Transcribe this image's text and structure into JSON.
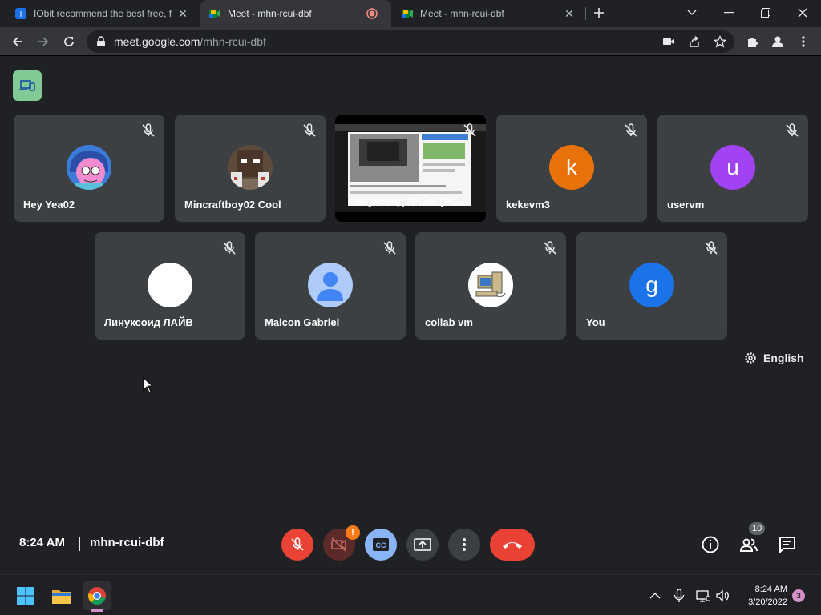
{
  "browser": {
    "tabs": [
      {
        "title": "IObit recommend the best free, f",
        "active": false
      },
      {
        "title": "Meet - mhn-rcui-dbf",
        "active": true
      },
      {
        "title": "Meet - mhn-rcui-dbf",
        "active": false
      }
    ],
    "url_host": "meet.google.com",
    "url_path": "/mhn-rcui-dbf"
  },
  "meet": {
    "participants_row1": [
      {
        "name": "Hey Yea02",
        "avatar": "pink-cartoon-avatar"
      },
      {
        "name": "Mincraftboy02 Cool",
        "avatar": "minecraft-avatar"
      },
      {
        "name": "Линуксоид ЛАЙВ (Pr...",
        "avatar": "screen-share"
      },
      {
        "name": "kekevm3",
        "avatar_letter": "k",
        "color": "#e8710a"
      },
      {
        "name": "uservm",
        "avatar_letter": "u",
        "color": "#a142f4"
      }
    ],
    "participants_row2": [
      {
        "name": "Линуксоид ЛАЙВ",
        "avatar": "white-circle"
      },
      {
        "name": "Maicon Gabriel",
        "avatar": "default-person"
      },
      {
        "name": "collab vm",
        "avatar": "computer-avatar"
      },
      {
        "name": "You",
        "avatar_letter": "g",
        "color": "#1a73e8"
      }
    ],
    "captions_language": "English",
    "time": "8:24 AM",
    "meeting_code": "mhn-rcui-dbf",
    "camera_warning": "!",
    "participant_count": "10"
  },
  "taskbar": {
    "time": "8:24 AM",
    "date": "3/20/2022",
    "notifications": "3"
  }
}
